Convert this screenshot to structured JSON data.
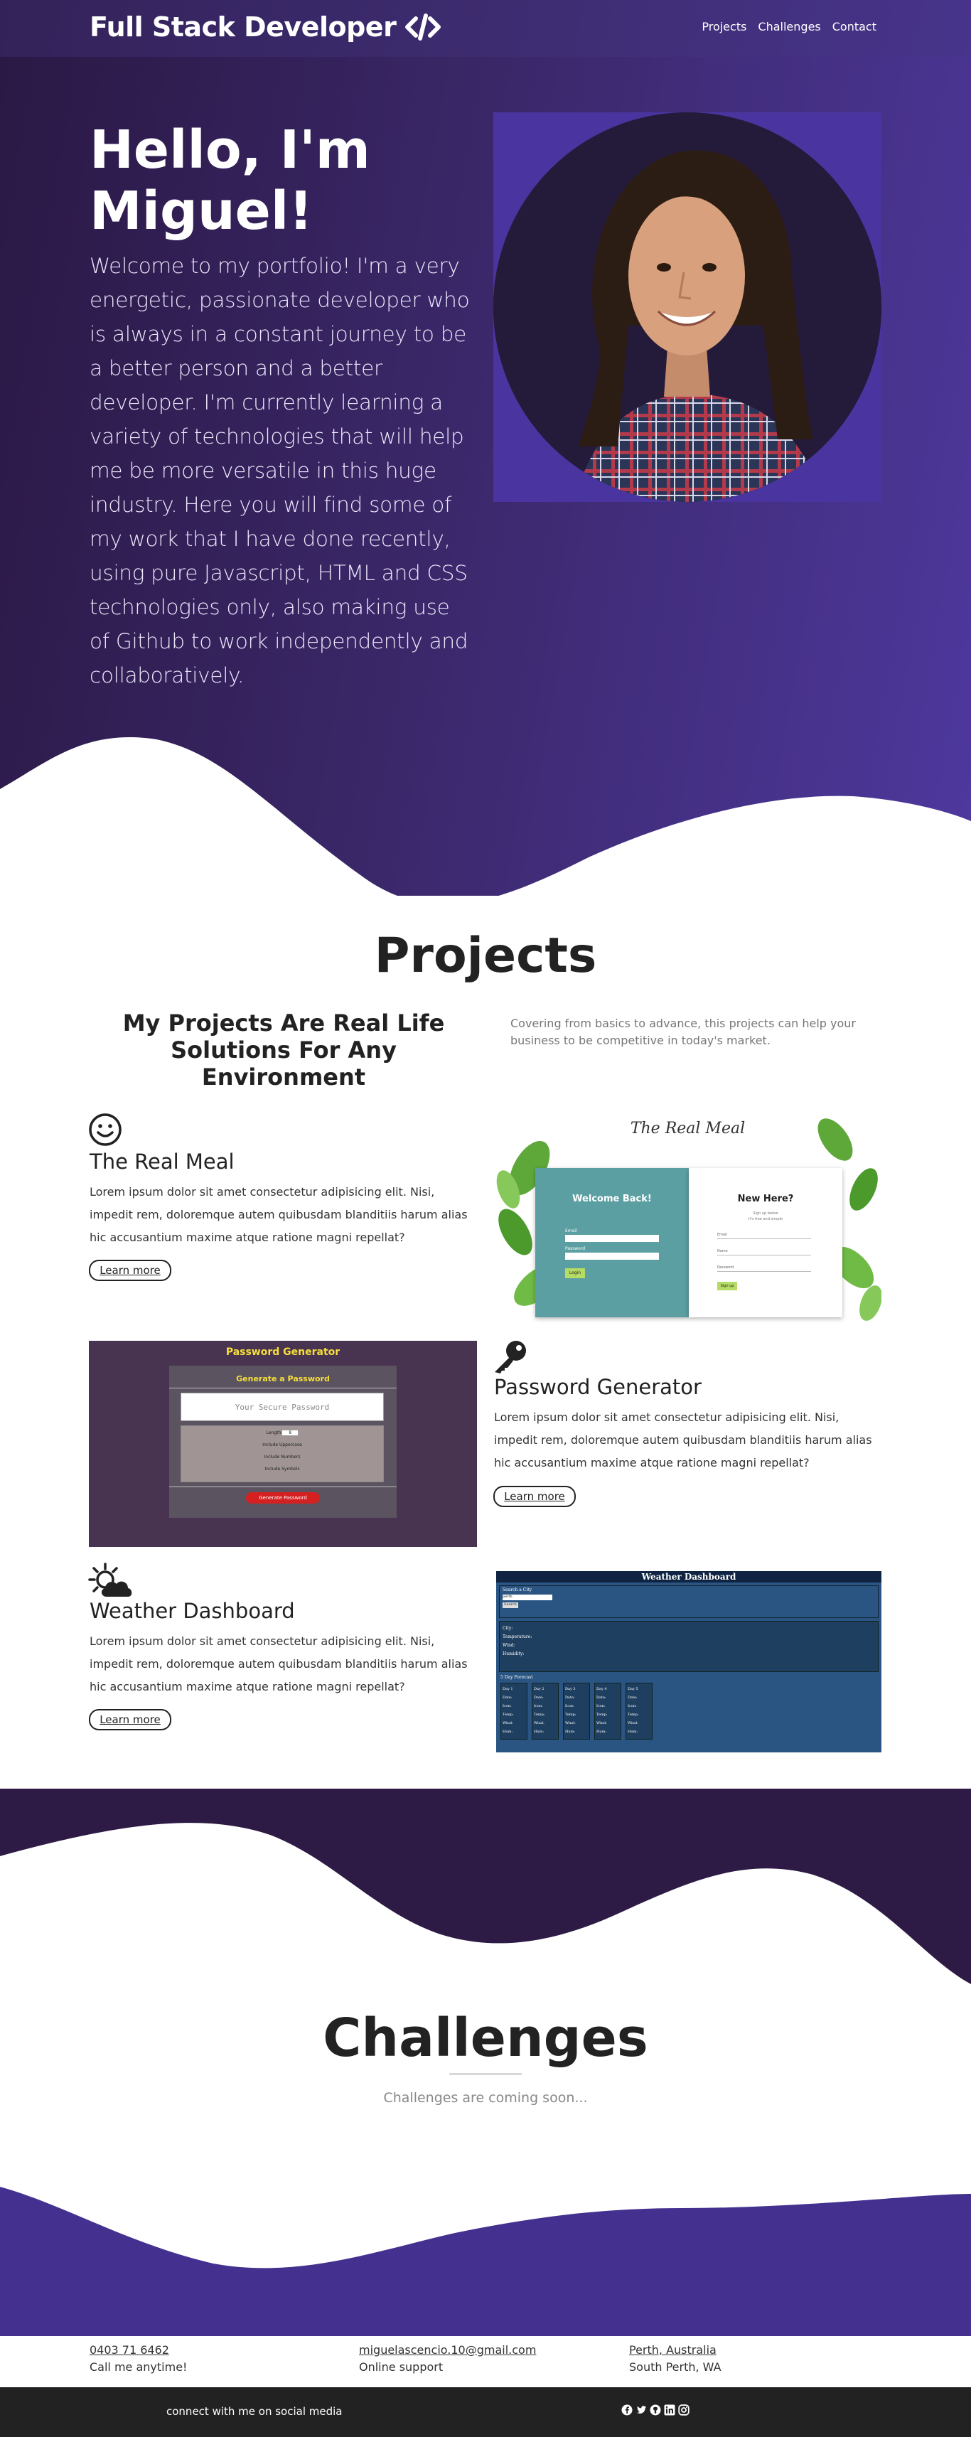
{
  "nav": {
    "brand": "Full Stack Developer",
    "brand_icon": "code-icon",
    "links": [
      "Projects",
      "Challenges",
      "Contact"
    ]
  },
  "hero": {
    "title": "Hello, I'm Miguel!",
    "text": "Welcome to my portfolio! I'm a very energetic, passionate developer who is always in a constant journey to be a better person and a better developer. I'm currently learning a variety of technologies that will help me be more versatile in this huge industry. Here you will find some of my work that I have done recently, using pure Javascript, HTML and CSS technologies only, also making use of Github to work independently and collaboratively."
  },
  "projects": {
    "title": "Projects",
    "subtitle": "My Projects Are Real Life Solutions For Any Environment",
    "description": "Covering from basics to advance, this projects can help your business to be competitive in today's market.",
    "items": [
      {
        "icon": "smiley-icon",
        "title": "The Real Meal",
        "text": "Lorem ipsum dolor sit amet consectetur adipisicing elit. Nisi, impedit rem, doloremque autem quibusdam blanditiis harum alias hic accusantium maxime atque ratione magni repellat?",
        "button": "Learn more",
        "screenshot": {
          "logo": "The Real Meal",
          "left_title": "Welcome Back!",
          "right_title": "New Here?",
          "right_sub1": "Sign up below",
          "right_sub2": "It's free and simple",
          "field_email": "Email",
          "field_password": "Password",
          "field_name": "Name",
          "login_btn": "Login",
          "signup_btn": "Sign up"
        }
      },
      {
        "icon": "key-icon",
        "title": "Password Generator",
        "text": "Lorem ipsum dolor sit amet consectetur adipisicing elit. Nisi, impedit rem, doloremque autem quibusdam blanditiis harum alias hic accusantium maxime atque ratione magni repellat?",
        "button": "Learn more",
        "screenshot": {
          "heading": "Password Generator",
          "card_title": "Generate a Password",
          "placeholder": "Your Secure Password",
          "length_label": "Length",
          "length_value": "8",
          "options": [
            "Include Uppercase",
            "Include Numbers",
            "Include Symbols"
          ],
          "button": "Generate Password"
        }
      },
      {
        "icon": "weather-icon",
        "title": "Weather Dashboard",
        "text": "Lorem ipsum dolor sit amet consectetur adipisicing elit. Nisi, impedit rem, doloremque autem quibusdam blanditiis harum alias hic accusantium maxime atque ratione magni repellat?",
        "button": "Learn more",
        "screenshot": {
          "heading": "Weather Dashboard",
          "search_label": "Search a City",
          "search_value": "perth",
          "search_btn": "Search",
          "current": [
            "City:",
            "Temperature:",
            "Wind:",
            "Humidity:"
          ],
          "forecast_label": "5 Day Forecast",
          "days": [
            "Day 1",
            "Day 2",
            "Day 3",
            "Day 4",
            "Day 5"
          ],
          "rows": [
            "Date:",
            "Icon:",
            "Temp:",
            "Wind:",
            "Hum:"
          ]
        }
      }
    ]
  },
  "challenges": {
    "title": "Challenges",
    "text": "Challenges are coming soon..."
  },
  "contact": {
    "phone": "0403 71 6462",
    "phone_note": "Call me anytime!",
    "email": "miguelascencio.10@gmail.com",
    "email_note": "Online support",
    "location": "Perth, Australia",
    "location_note": "South Perth, WA"
  },
  "social": {
    "text": "connect with me on social media",
    "icons": [
      "facebook-icon",
      "twitter-icon",
      "github-icon",
      "linkedin-icon",
      "instagram-icon"
    ]
  },
  "colors": {
    "hero_dark": "#2a1844",
    "hero_light": "#4e389e",
    "challenge_wave_dark": "#2d1b45",
    "challenge_wave_purple": "#44318f",
    "footer_bar": "#222222"
  }
}
